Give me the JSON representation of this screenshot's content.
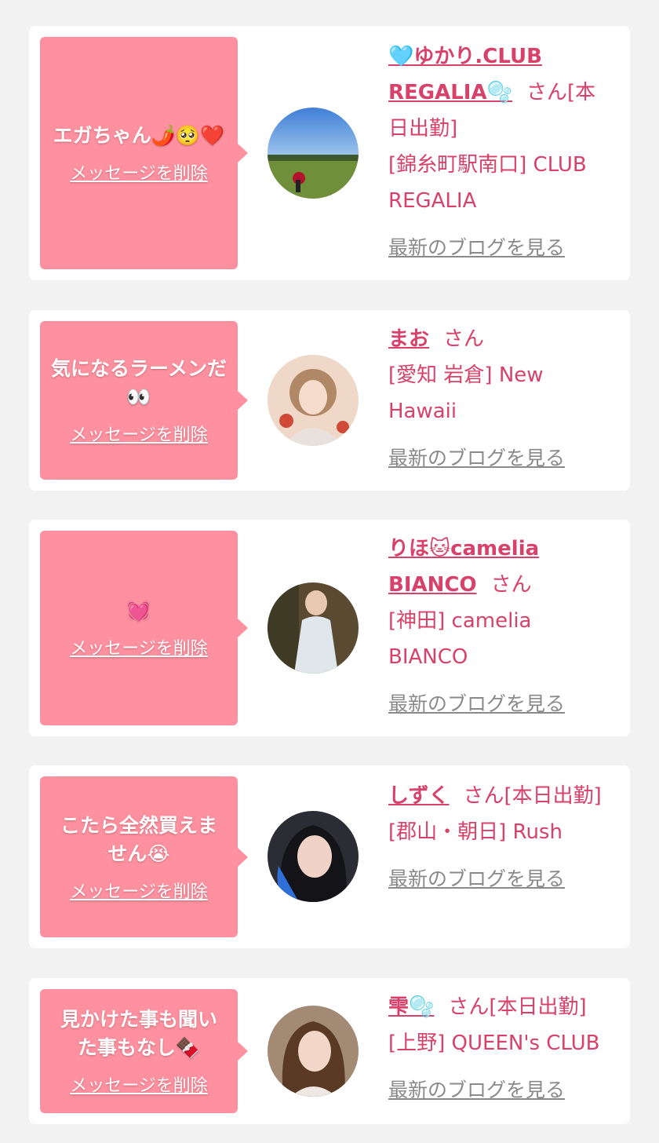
{
  "cards": [
    {
      "message": "エガちゃん🌶️🥺❤️",
      "delete_label": "メッセージを削除",
      "name": "🩵ゆかり.CLUB REGALIA🫧",
      "san": "さん[本日出勤]",
      "location": "[錦糸町駅南口] CLUB REGALIA",
      "blog_label": "最新のブログを見る"
    },
    {
      "message": "気になるラーメンだ👀",
      "delete_label": "メッセージを削除",
      "name": "まお",
      "san": "さん",
      "location": "[愛知 岩倉] New Hawaii",
      "blog_label": "最新のブログを見る"
    },
    {
      "message": "💓",
      "delete_label": "メッセージを削除",
      "name": "りほ🐱camelia BIANCO",
      "san": "さん",
      "location": "[神田] camelia BIANCO",
      "blog_label": "最新のブログを見る"
    },
    {
      "message": "こたら全然買えません😭",
      "delete_label": "メッセージを削除",
      "name": "しずく",
      "san": "さん[本日出勤]",
      "location": "[郡山・朝日] Rush",
      "blog_label": "最新のブログを見る"
    },
    {
      "message": "見かけた事も聞いた事もなし🍫",
      "delete_label": "メッセージを削除",
      "name": "雫🫧",
      "san": "さん[本日出勤]",
      "location": "[上野] QUEEN's CLUB",
      "blog_label": "最新のブログを見る"
    }
  ]
}
